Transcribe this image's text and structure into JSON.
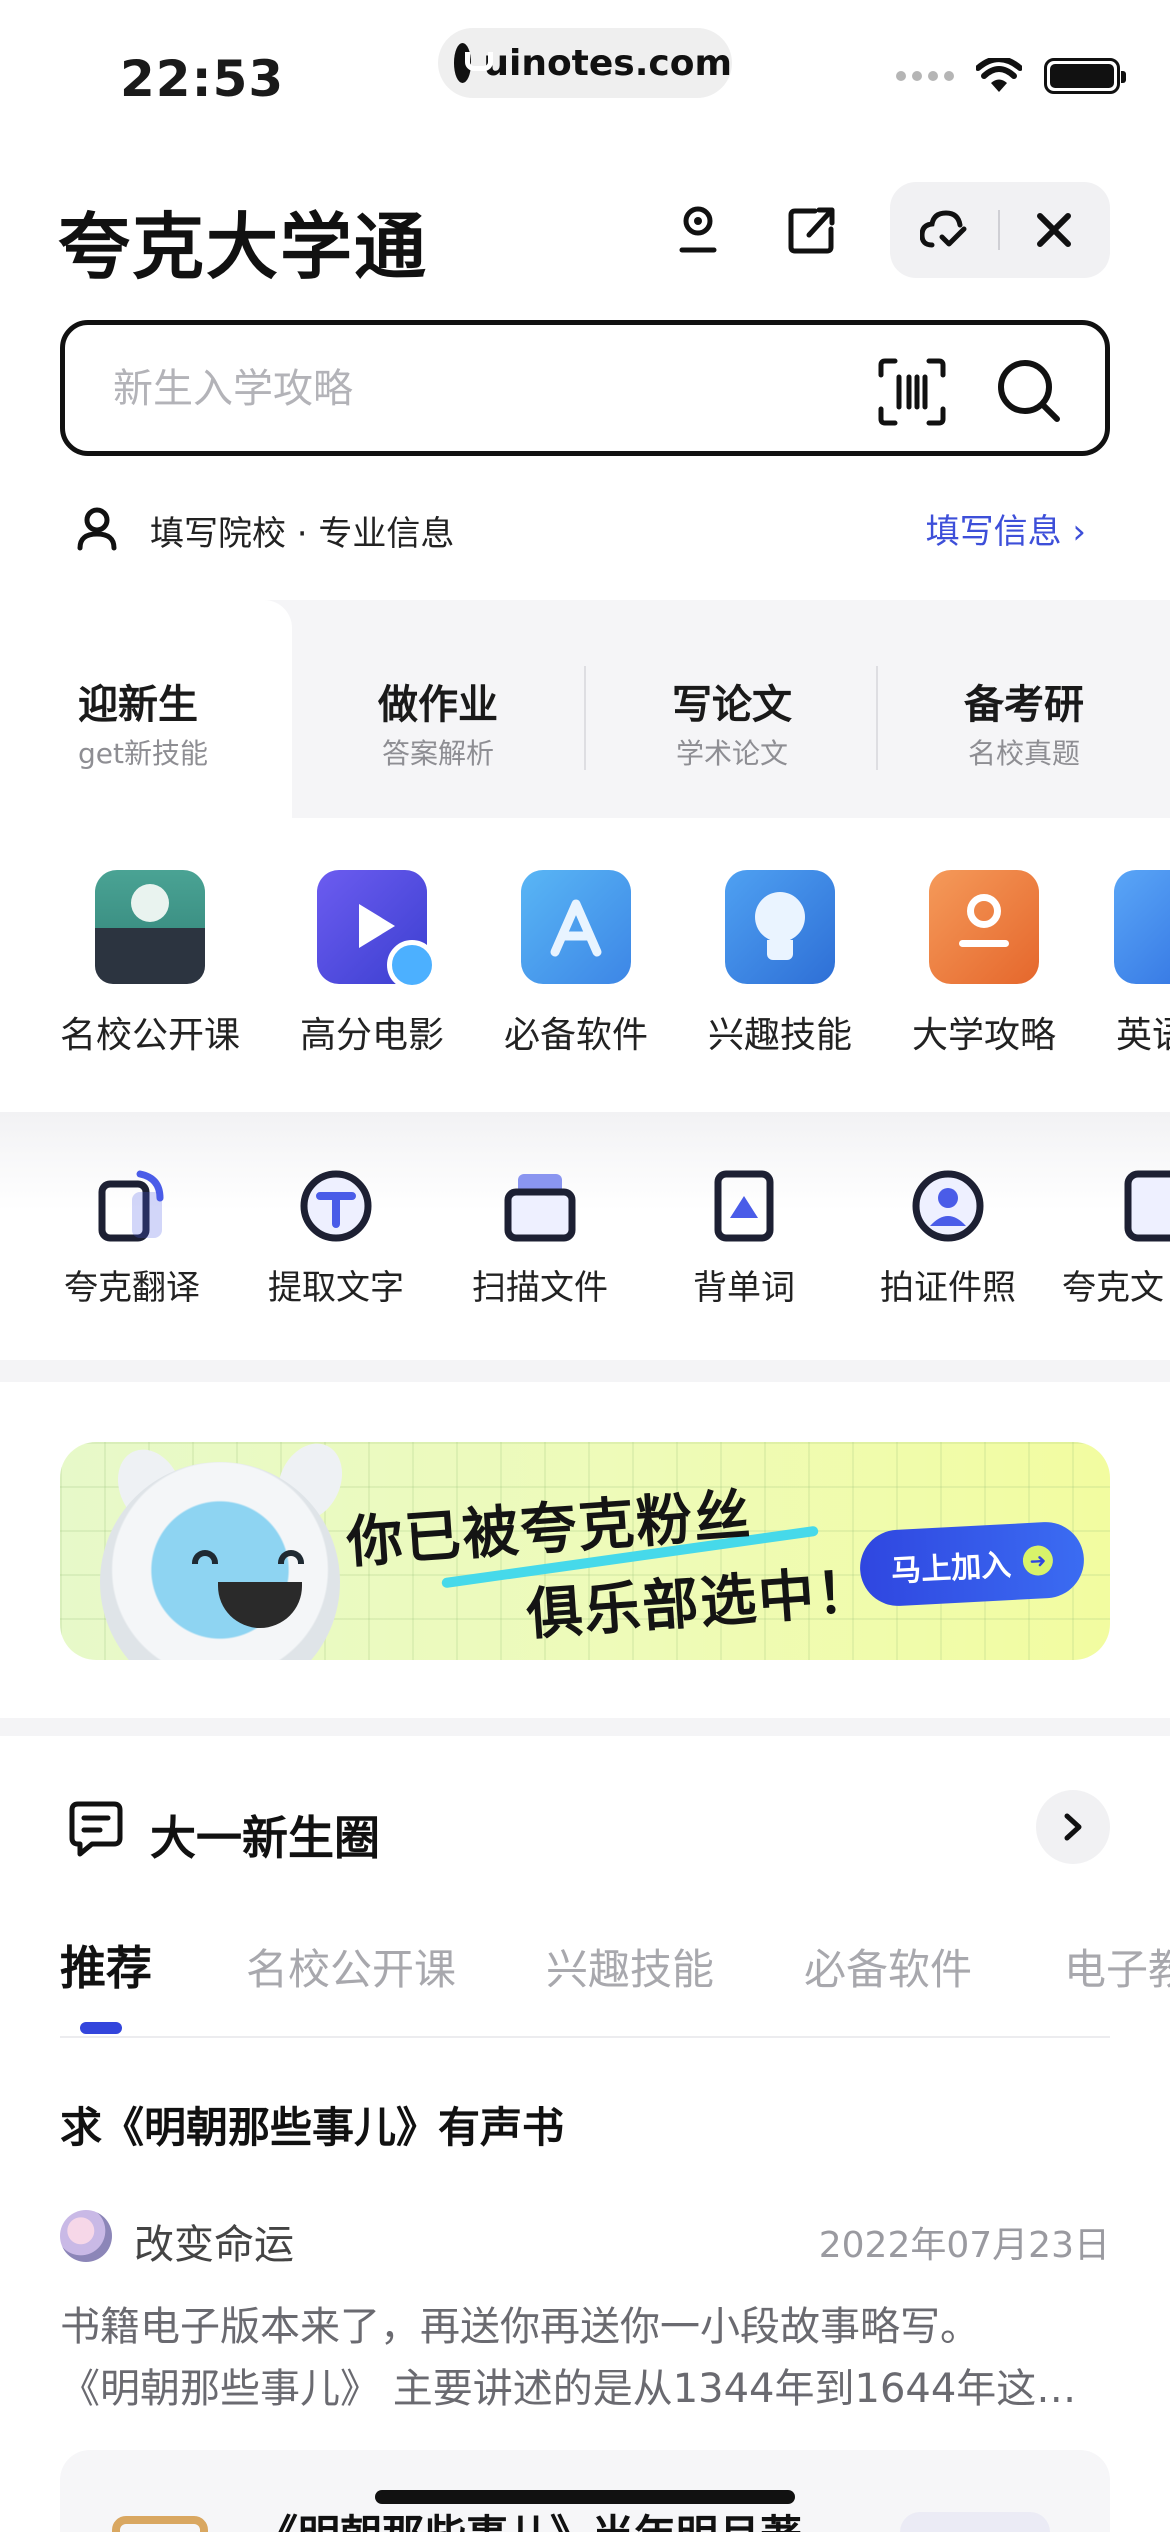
{
  "status_bar": {
    "time": "22:53",
    "url": "uinotes.com"
  },
  "header": {
    "title": "夸克大学通",
    "icons": [
      "person-icon",
      "share-icon",
      "cloud-check-icon",
      "close-icon"
    ]
  },
  "search": {
    "placeholder": "新生入学攻略",
    "value": ""
  },
  "profile": {
    "text": "填写院校 · 专业信息",
    "link": "填写信息 ›"
  },
  "category_tabs": [
    {
      "title": "迎新生",
      "subtitle": "get新技能",
      "active": true
    },
    {
      "title": "做作业",
      "subtitle": "答案解析",
      "active": false
    },
    {
      "title": "写论文",
      "subtitle": "学术论文",
      "active": false
    },
    {
      "title": "备考研",
      "subtitle": "名校真题",
      "active": false
    }
  ],
  "features": [
    {
      "label": "名校公开课",
      "icon": "lecture-podium-icon"
    },
    {
      "label": "高分电影",
      "icon": "movie-play-icon"
    },
    {
      "label": "必备软件",
      "icon": "app-store-icon"
    },
    {
      "label": "兴趣技能",
      "icon": "bulb-brain-icon"
    },
    {
      "label": "大学攻略",
      "icon": "guide-book-icon"
    },
    {
      "label": "英语",
      "icon": "english-icon"
    }
  ],
  "tools": [
    {
      "label": "夸克翻译",
      "icon": "translate-icon"
    },
    {
      "label": "提取文字",
      "icon": "extract-text-icon"
    },
    {
      "label": "扫描文件",
      "icon": "scan-file-icon"
    },
    {
      "label": "背单词",
      "icon": "vocabulary-icon"
    },
    {
      "label": "拍证件照",
      "icon": "id-photo-icon"
    },
    {
      "label": "夸克文",
      "icon": "quark-doc-icon"
    }
  ],
  "banner": {
    "line1": "你已被夸克粉丝",
    "line2": "俱乐部选中！",
    "cta": "马上加入"
  },
  "circle": {
    "title": "大一新生圈",
    "tabs": [
      "推荐",
      "名校公开课",
      "兴趣技能",
      "必备软件",
      "电子教"
    ],
    "active_tab": "推荐"
  },
  "post": {
    "title": "求《明朝那些事儿》有声书",
    "author": "改变命运",
    "date": "2022年07月23日",
    "body_line1": "书籍电子版本来了，再送你再送你一小段故事略写。",
    "body_line2": "《明朝那些事儿》 主要讲述的是从1344年到1644年这…",
    "card_title": "《明朝那些事儿》当年明月著"
  },
  "colors": {
    "accent": "#3345dc",
    "link": "#3d4fd9",
    "banner_bg": "#eefbb8"
  }
}
